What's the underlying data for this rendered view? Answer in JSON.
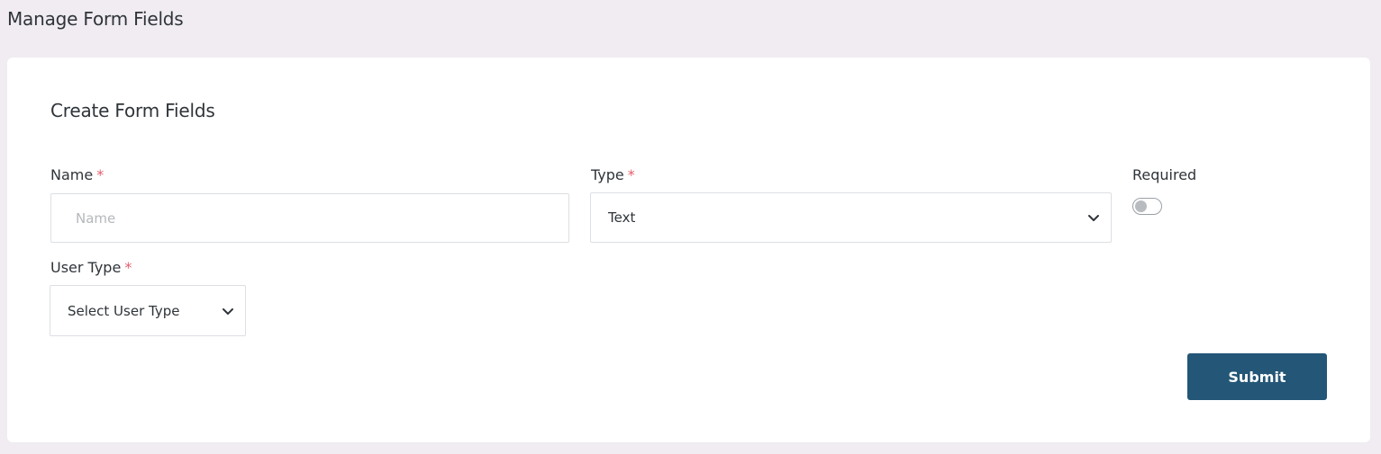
{
  "header": {
    "title": "Manage Form Fields"
  },
  "form": {
    "title": "Create Form Fields",
    "required_marker": "*",
    "name": {
      "label": "Name",
      "placeholder": "Name",
      "value": ""
    },
    "type": {
      "label": "Type",
      "selected": "Text"
    },
    "required": {
      "label": "Required",
      "checked": false
    },
    "user_type": {
      "label": "User Type",
      "selected": "Select User Type"
    },
    "submit_label": "Submit"
  },
  "icons": {
    "select_chevron": "chevron-down-icon"
  },
  "colors": {
    "page_background": "#f0ecf2",
    "accent": "#235677",
    "required_marker": "#e35d6a"
  }
}
